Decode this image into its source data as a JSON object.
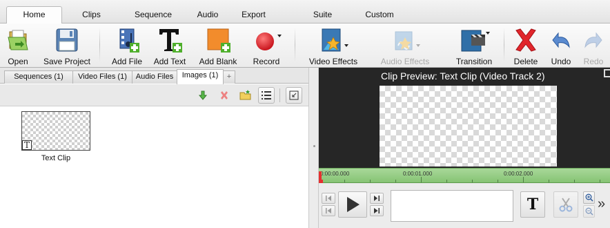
{
  "menu_tabs": [
    "Home",
    "Clips",
    "Sequence",
    "Audio",
    "Export",
    "Suite",
    "Custom"
  ],
  "active_menu_tab": "Home",
  "ribbon": {
    "open": "Open",
    "save_project": "Save Project",
    "add_file": "Add File",
    "add_text": "Add Text",
    "add_blank": "Add Blank",
    "record": "Record",
    "video_effects": "Video Effects",
    "audio_effects": "Audio Effects",
    "transition": "Transition",
    "delete": "Delete",
    "undo": "Undo",
    "redo": "Redo"
  },
  "media_tabs": {
    "sequences": "Sequences (1)",
    "video_files": "Video Files (1)",
    "audio_files": "Audio Files",
    "images": "Images (1)",
    "add": "+"
  },
  "active_media_tab": "Images (1)",
  "media_items": [
    {
      "label": "Text Clip",
      "badge": "T"
    }
  ],
  "preview": {
    "title": "Clip Preview: Text Clip (Video Track 2)"
  },
  "timeline": {
    "labels": [
      "0:00:00.000",
      "0:00:01.000",
      "0:00:02.000"
    ]
  },
  "transport": {
    "text_button": "T",
    "more": "»"
  },
  "colors": {
    "accent_green": "#8ccb7a",
    "playhead": "#e53030",
    "preview_bg": "#262626"
  }
}
